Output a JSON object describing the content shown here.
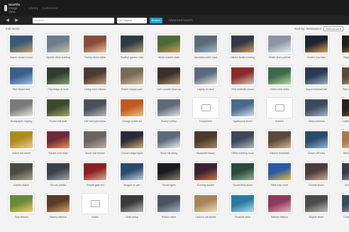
{
  "header": {
    "logo_text": "NexFile",
    "logo_sub": "Image View",
    "nav": [
      "Library",
      "Collections"
    ]
  },
  "toolbar": {
    "back_icon": "◀",
    "forward_icon": "▶",
    "search_placeholder": "Search",
    "select_value": "All Folders",
    "search_button": "Search",
    "adv_link": "Advanced search"
  },
  "results": {
    "count_label": "240 items",
    "sort_label": "Sort by: Relevance",
    "sort_value": "Relevance"
  },
  "tiles": [
    {
      "caption": "Beach sunset crowd",
      "colors": [
        "#3a5a7a",
        "#c9a56b"
      ],
      "kind": "photo"
    },
    {
      "caption": "Skyline office building",
      "colors": [
        "#6d7d8d",
        "#c8c2b0"
      ],
      "kind": "photo"
    },
    {
      "caption": "Family dinner table",
      "colors": [
        "#8a4a3a",
        "#e2c7a0"
      ],
      "kind": "photo"
    },
    {
      "caption": "Rooftop garden view",
      "colors": [
        "#2e3a42",
        "#b9a17d"
      ],
      "kind": "photo"
    },
    {
      "caption": "Street market stalls",
      "colors": [
        "#4b6a3a",
        "#cf9a5a"
      ],
      "kind": "photo"
    },
    {
      "caption": "Mountain cabin road",
      "colors": [
        "#5a6b78",
        "#a8b8c2"
      ],
      "kind": "photo"
    },
    {
      "caption": "Harbor boats morning",
      "colors": [
        "#2f3a44",
        "#d8a060"
      ],
      "kind": "photo"
    },
    {
      "caption": "Winter team portrait",
      "colors": [
        "#8896a6",
        "#e6eef4"
      ],
      "kind": "photo"
    },
    {
      "caption": "Golden hour lake",
      "colors": [
        "#1b2430",
        "#e0a050"
      ],
      "kind": "photo"
    },
    {
      "caption": "Night street lights",
      "colors": [
        "#241c18",
        "#c07040"
      ],
      "kind": "photo"
    },
    {
      "caption": "Blue flower field",
      "colors": [
        "#3a5f8a",
        "#9cc0e0"
      ],
      "kind": "photo"
    },
    {
      "caption": "City bridge at dusk",
      "colors": [
        "#2f3f2f",
        "#8aa070"
      ],
      "kind": "photo"
    },
    {
      "caption": "Living room interior",
      "colors": [
        "#4a3a30",
        "#c0a080"
      ],
      "kind": "photo"
    },
    {
      "caption": "Desert canyon path",
      "colors": [
        "#7a6a5a",
        "#d4c4a0"
      ],
      "kind": "photo"
    },
    {
      "caption": "Cafe counter close-up",
      "colors": [
        "#3a3028",
        "#b49a78"
      ],
      "kind": "photo"
    },
    {
      "caption": "Laptop on desk",
      "colors": [
        "#5a6a7a",
        "#e8e8e8"
      ],
      "kind": "photo"
    },
    {
      "caption": "Red umbrella crowd",
      "colors": [
        "#8a2a2a",
        "#d8c8b8"
      ],
      "kind": "photo"
    },
    {
      "caption": "Green river delta",
      "colors": [
        "#3a6a4a",
        "#b8d8a0"
      ],
      "kind": "photo"
    },
    {
      "caption": "Airport terminal hall",
      "colors": [
        "#2a3a52",
        "#a0b0c8"
      ],
      "kind": "photo"
    },
    {
      "caption": "Park bench autumn",
      "colors": [
        "#5a4a3a",
        "#c8b090"
      ],
      "kind": "photo"
    },
    {
      "caption": "Newspaper clipping",
      "colors": [
        "#7a7a7a",
        "#e8e4dc"
      ],
      "kind": "photo"
    },
    {
      "caption": "Forest trail walk",
      "colors": [
        "#3a4a2a",
        "#a4a870"
      ],
      "kind": "photo"
    },
    {
      "caption": "Hill road panorama",
      "colors": [
        "#4a5058",
        "#b8bcc0"
      ],
      "kind": "photo"
    },
    {
      "caption": "Orange poster art",
      "colors": [
        "#c05a20",
        "#f0c080"
      ],
      "kind": "photo"
    },
    {
      "caption": "Snowy rooftop",
      "colors": [
        "#606a74",
        "#e0e4e8"
      ],
      "kind": "photo"
    },
    {
      "caption": "Documents",
      "colors": [],
      "kind": "folder"
    },
    {
      "caption": "Lighthouse shore",
      "colors": [
        "#4a6a8a",
        "#d0e0ec"
      ],
      "kind": "photo"
    },
    {
      "caption": "Archive",
      "colors": [],
      "kind": "folder"
    },
    {
      "caption": "Valley overlook",
      "colors": [
        "#3a4a5a",
        "#a8b8c8"
      ],
      "kind": "photo"
    },
    {
      "caption": "Coffee beans macro",
      "colors": [
        "#2a2018",
        "#8a6040"
      ],
      "kind": "photo"
    },
    {
      "caption": "Yellow taxi street",
      "colors": [
        "#b08a20",
        "#e8d090"
      ],
      "kind": "photo"
    },
    {
      "caption": "Sunset over ridge",
      "colors": [
        "#6a2a3a",
        "#f09050"
      ],
      "kind": "photo"
    },
    {
      "caption": "Stone wall texture",
      "colors": [
        "#6a6460",
        "#b8b0a8"
      ],
      "kind": "photo"
    },
    {
      "caption": "Concert stage lights",
      "colors": [
        "#2a2a3a",
        "#d0b070"
      ],
      "kind": "photo"
    },
    {
      "caption": "Snow hill skiing",
      "colors": [
        "#5a6a7a",
        "#eef2f6"
      ],
      "kind": "photo"
    },
    {
      "caption": "Bookshelf library",
      "colors": [
        "#4a3828",
        "#a88868"
      ],
      "kind": "photo"
    },
    {
      "caption": "Office meeting room",
      "colors": [
        "#3a4858",
        "#b0bcc8"
      ],
      "kind": "photo"
    },
    {
      "caption": "Kitchen breakfast",
      "colors": [
        "#5a4838",
        "#d0b898"
      ],
      "kind": "photo"
    },
    {
      "caption": "Ocean cliff view",
      "colors": [
        "#2a4a6a",
        "#90b8d8"
      ],
      "kind": "photo"
    },
    {
      "caption": "Wedding invitation",
      "colors": [
        "#a87850",
        "#f0d8b0"
      ],
      "kind": "photo"
    },
    {
      "caption": "Garden statue",
      "colors": [
        "#4a4a40",
        "#b0a890"
      ],
      "kind": "photo"
    },
    {
      "caption": "Old car parked",
      "colors": [
        "#3a4048",
        "#a0a8b0"
      ],
      "kind": "photo"
    },
    {
      "caption": "Temple gate red",
      "colors": [
        "#8a2020",
        "#e0b0a0"
      ],
      "kind": "photo"
    },
    {
      "caption": "Seagull on pier",
      "colors": [
        "#2a4a6a",
        "#c0d4e4"
      ],
      "kind": "photo"
    },
    {
      "caption": "Tunnel lights",
      "colors": [
        "#1a1a20",
        "#8a8070"
      ],
      "kind": "photo"
    },
    {
      "caption": "Evening skyline",
      "colors": [
        "#3a2030",
        "#d07840"
      ],
      "kind": "photo"
    },
    {
      "caption": "Sports field aerial",
      "colors": [
        "#2a4a3a",
        "#90b890"
      ],
      "kind": "photo"
    },
    {
      "caption": "Heat map chart",
      "colors": [
        "#2a5aa0",
        "#e0c040"
      ],
      "kind": "photo"
    },
    {
      "caption": "Portrait studio",
      "colors": [
        "#4a3a3a",
        "#c8b0a0"
      ],
      "kind": "photo"
    },
    {
      "caption": "Schedule board",
      "colors": [
        "#3a3a4a",
        "#b0b0c0"
      ],
      "kind": "photo"
    },
    {
      "caption": "Tulip flowers",
      "colors": [
        "#6a8a3a",
        "#f0d060"
      ],
      "kind": "photo"
    },
    {
      "caption": "Bakery window",
      "colors": [
        "#5a3a28",
        "#d8a878"
      ],
      "kind": "photo"
    },
    {
      "caption": "Notes",
      "colors": [],
      "kind": "folder"
    },
    {
      "caption": "Desk setup",
      "colors": [
        "#3a3a3a",
        "#b8b8b8"
      ],
      "kind": "photo"
    },
    {
      "caption": "Harbor crane",
      "colors": [
        "#4a5460",
        "#a8b4c0"
      ],
      "kind": "photo"
    },
    {
      "caption": "Cartoon cat sticker",
      "colors": [
        "#a8845a",
        "#f0e0c0"
      ],
      "kind": "photo"
    },
    {
      "caption": "Poolside deck",
      "colors": [
        "#2a7aa0",
        "#b0e0f0"
      ],
      "kind": "photo"
    },
    {
      "caption": "Balloon festival",
      "colors": [
        "#8a3a5a",
        "#e8b0c0"
      ],
      "kind": "photo"
    },
    {
      "caption": "Bicycle street",
      "colors": [
        "#4a4a4a",
        "#c0c0b8"
      ],
      "kind": "photo"
    },
    {
      "caption": "Crowd at stadium",
      "colors": [
        "#3a4a5a",
        "#b0b8c0"
      ],
      "kind": "photo"
    }
  ]
}
